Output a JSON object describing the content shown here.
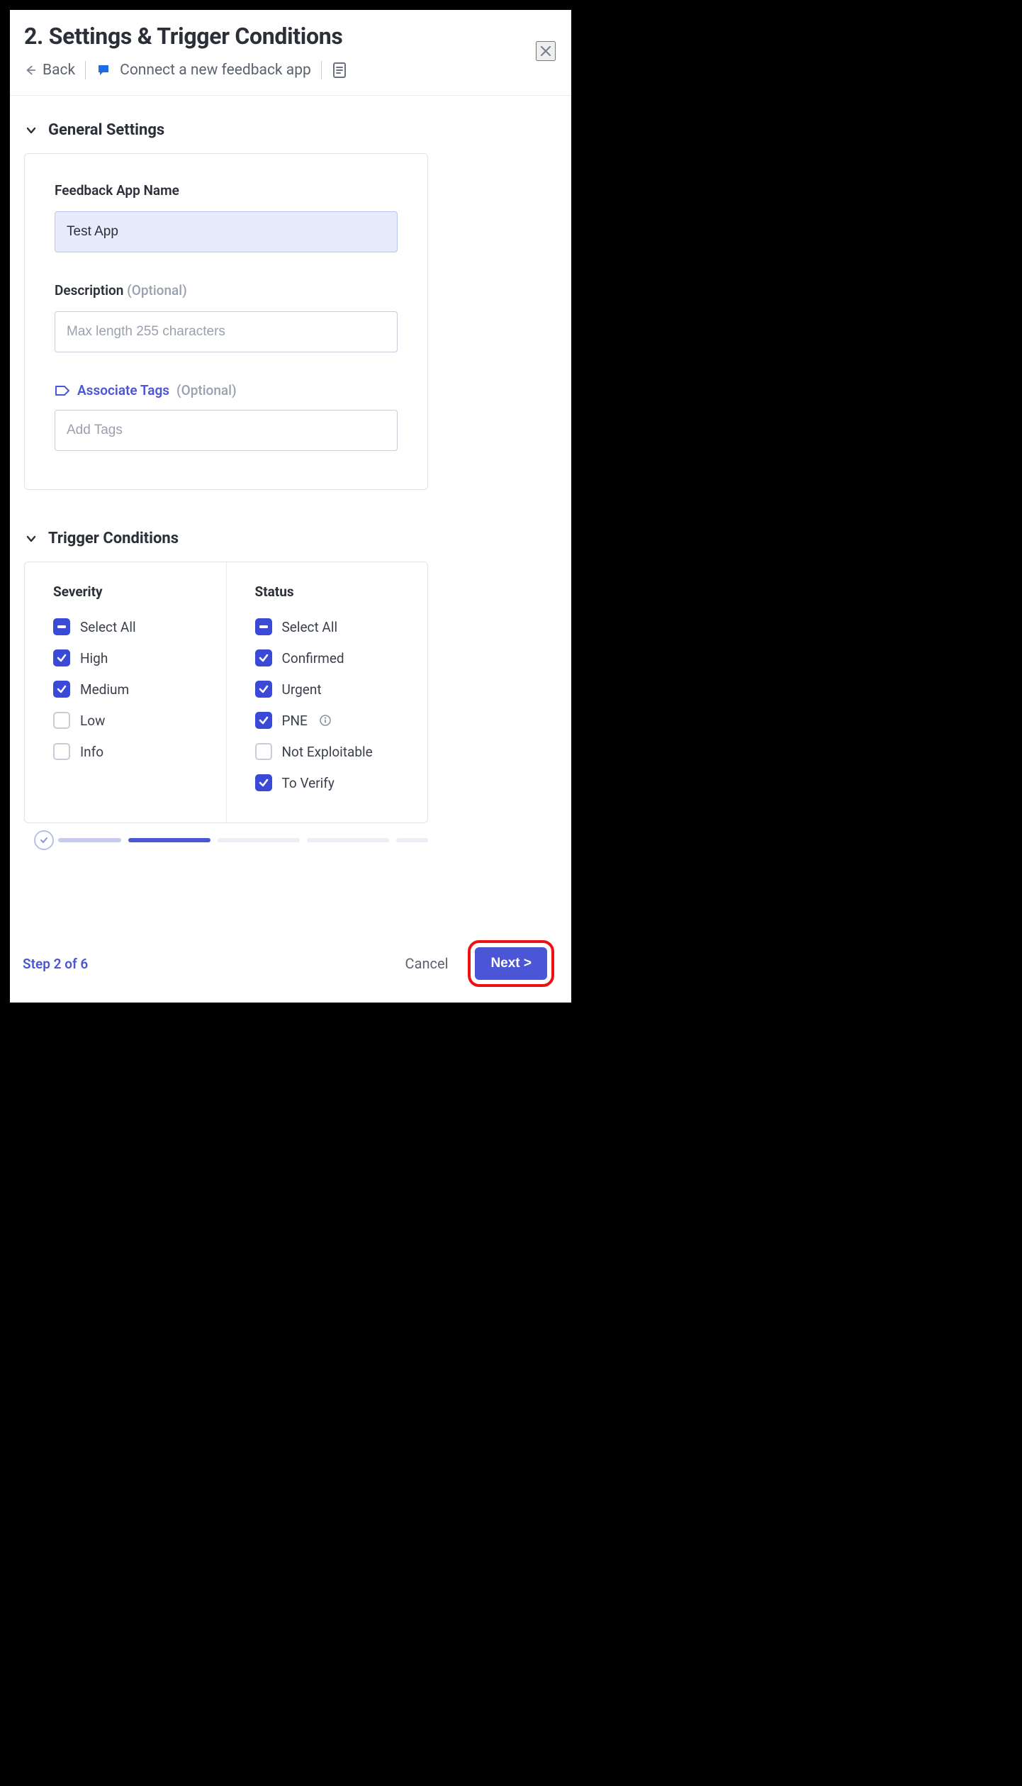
{
  "header": {
    "title": "2. Settings & Trigger Conditions",
    "back_label": "Back",
    "connect_label": "Connect a new feedback app"
  },
  "sections": {
    "general": {
      "title": "General Settings",
      "app_name_label": "Feedback App Name",
      "app_name_value": "Test App",
      "description_label": "Description",
      "description_optional": "(Optional)",
      "description_placeholder": "Max length 255 characters",
      "associate_tags_label": "Associate Tags",
      "associate_tags_optional": "(Optional)",
      "tags_placeholder": "Add Tags"
    },
    "trigger": {
      "title": "Trigger Conditions",
      "severity": {
        "title": "Severity",
        "select_all": "Select All",
        "items": [
          {
            "label": "High",
            "checked": true
          },
          {
            "label": "Medium",
            "checked": true
          },
          {
            "label": "Low",
            "checked": false
          },
          {
            "label": "Info",
            "checked": false
          }
        ]
      },
      "status": {
        "title": "Status",
        "select_all": "Select All",
        "items": [
          {
            "label": "Confirmed",
            "checked": true
          },
          {
            "label": "Urgent",
            "checked": true
          },
          {
            "label": "PNE",
            "checked": true,
            "info": true
          },
          {
            "label": "Not Exploitable",
            "checked": false
          },
          {
            "label": "To Verify",
            "checked": true
          }
        ]
      }
    }
  },
  "footer": {
    "step_label": "Step 2 of 6",
    "cancel_label": "Cancel",
    "next_label": "Next >"
  }
}
